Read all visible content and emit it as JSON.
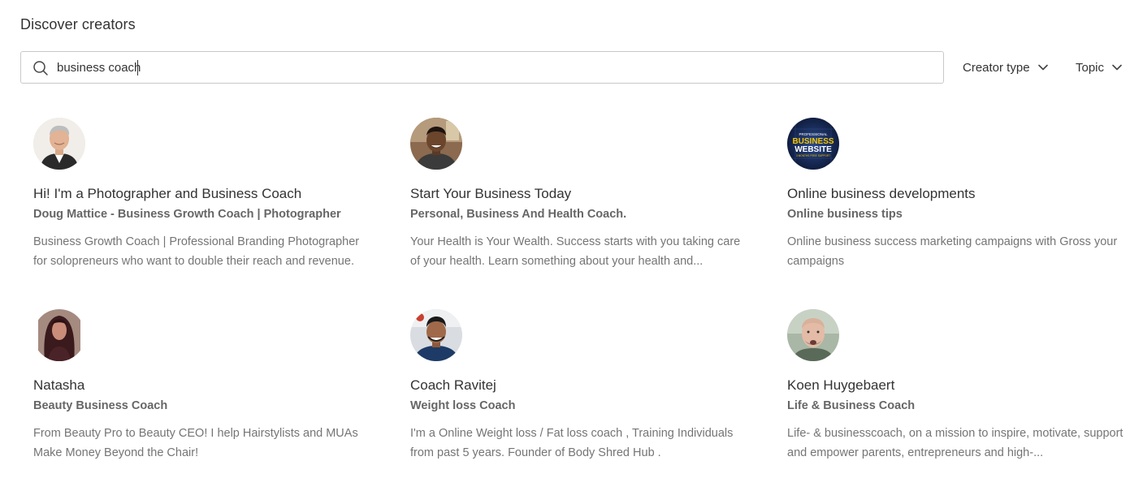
{
  "page": {
    "title": "Discover creators"
  },
  "search": {
    "value": "business coach",
    "placeholder": ""
  },
  "filters": [
    {
      "label": "Creator type"
    },
    {
      "label": "Topic"
    }
  ],
  "creators": [
    {
      "title": "Hi! I'm a Photographer and Business Coach",
      "subtitle": "Doug Mattice - Business Growth Coach | Photographer",
      "description": "Business Growth Coach | Professional Branding Photographer for solopreneurs who want to double their reach and revenue."
    },
    {
      "title": "Start Your Business Today",
      "subtitle": "Personal, Business And Health Coach.",
      "description": "Your Health is Your Wealth. Success starts with you taking care of your health. Learn something about your health and..."
    },
    {
      "title": "Online business developments",
      "subtitle": "Online business tips",
      "description": "Online business success marketing campaigns with Gross your campaigns",
      "avatar_text": [
        "PROFESSIONAL",
        "BUSINESS",
        "WEBSITE",
        "3 MONTHS FREE SUPPORT"
      ]
    },
    {
      "title": "Natasha",
      "subtitle": "Beauty Business Coach",
      "description": "From Beauty Pro to Beauty CEO! I help Hairstylists and MUAs Make Money Beyond the Chair!"
    },
    {
      "title": "Coach Ravitej",
      "subtitle": "Weight loss Coach",
      "description": "I'm a Online Weight loss / Fat loss coach , Training Individuals from past 5 years. Founder of Body Shred Hub ."
    },
    {
      "title": "Koen Huygebaert",
      "subtitle": "Life & Business Coach",
      "description": "Life- & businesscoach, on a mission to inspire, motivate, support and empower parents, entrepreneurs and high-..."
    }
  ],
  "colors": {
    "text_primary": "#333333",
    "text_subtitle": "#666666",
    "text_description": "#757575",
    "border": "#c9c9c9",
    "background": "#ffffff"
  },
  "icons": {
    "search": "search-icon",
    "dropdown": "chevron-down-icon"
  }
}
